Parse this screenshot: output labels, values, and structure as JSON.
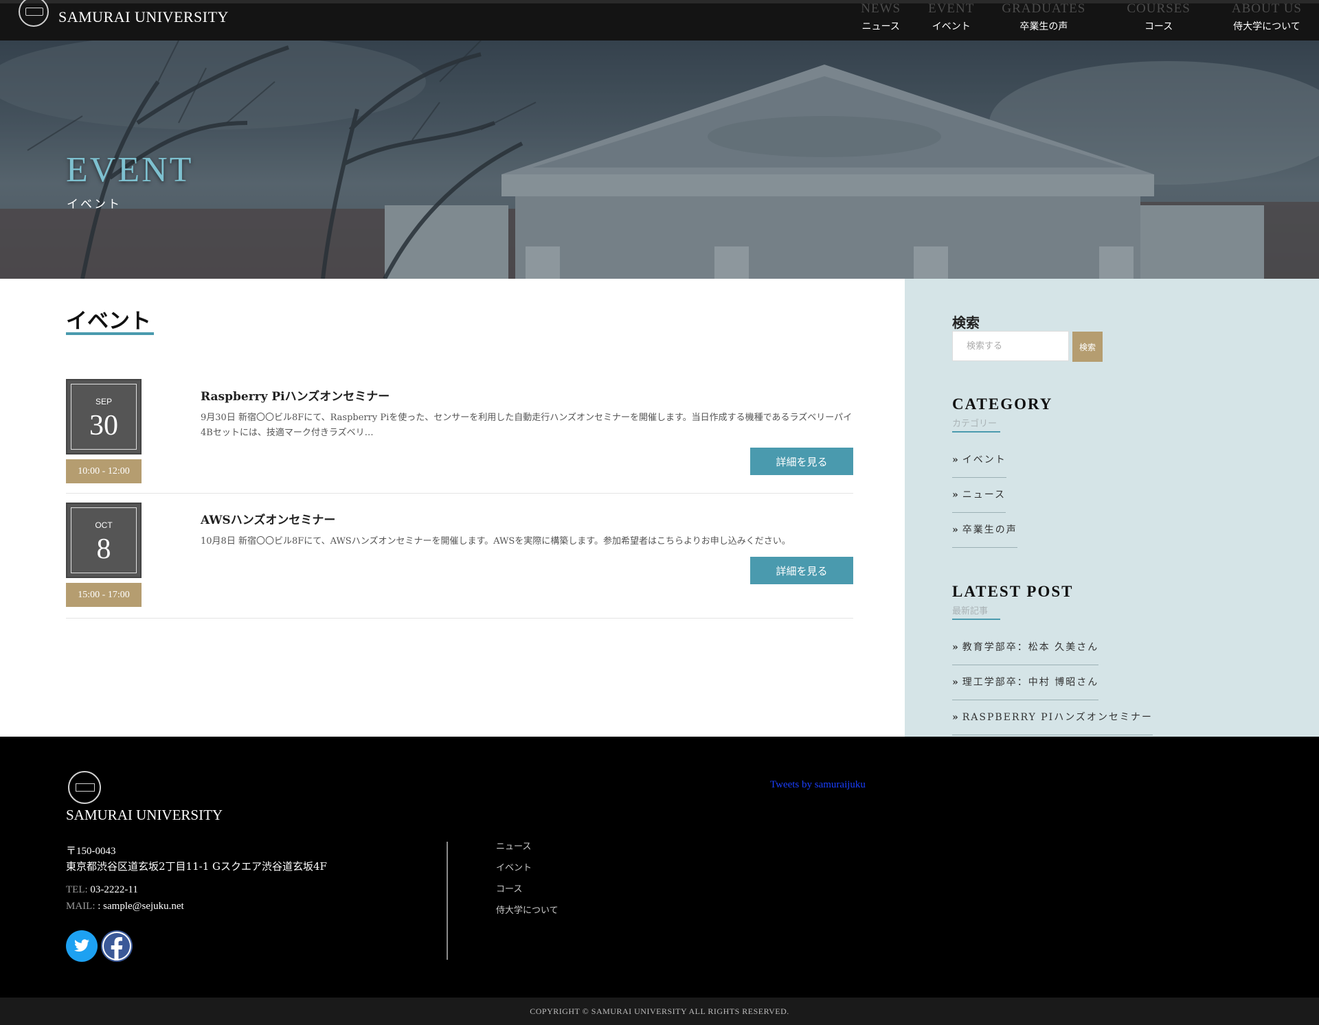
{
  "header": {
    "logo_text": "SAMURAI UNIVERSITY",
    "nav": [
      {
        "en": "NEWS",
        "ja": "ニュース"
      },
      {
        "en": "EVENT",
        "ja": "イベント"
      },
      {
        "en": "GRADUATES",
        "ja": "卒業生の声"
      },
      {
        "en": "COURSES",
        "ja": "コース"
      },
      {
        "en": "ABOUT US",
        "ja": "侍大学について"
      }
    ]
  },
  "hero": {
    "title": "EVENT",
    "subtitle": "イベント"
  },
  "main": {
    "heading": "イベント",
    "events": [
      {
        "month": "SEP",
        "day": "30",
        "time": "10:00 - 12:00",
        "title": "Raspberry Piハンズオンセミナー",
        "description": "9月30日 新宿〇〇ビル8Fにて、Raspberry Piを使った、センサーを利用した自動走行ハンズオンセミナーを開催します。当日作成する機種であるラズベリーパイ4Bセットには、技適マーク付きラズベリ…",
        "button": "詳細を見る"
      },
      {
        "month": "OCT",
        "day": "8",
        "time": "15:00 - 17:00",
        "title": "AWSハンズオンセミナー",
        "description": "10月8日 新宿〇〇ビル8Fにて、AWSハンズオンセミナーを開催します。AWSを実際に構築します。参加希望者はこちらよりお申し込みください。",
        "button": "詳細を見る"
      }
    ]
  },
  "sidebar": {
    "search": {
      "title": "検索",
      "placeholder": "検索する",
      "button": "検索"
    },
    "category": {
      "heading": "CATEGORY",
      "sub": "カテゴリー",
      "items": [
        "イベント",
        "ニュース",
        "卒業生の声"
      ]
    },
    "latest": {
      "heading": "LATEST POST",
      "sub": "最新記事",
      "items": [
        "教育学部卒：松本 久美さん",
        "理工学部卒：中村 博昭さん",
        "RASPBERRY PIハンズオンセミナー"
      ]
    }
  },
  "footer": {
    "logo_text": "SAMURAI UNIVERSITY",
    "postal": "〒150-0043",
    "address": "東京都渋谷区道玄坂2丁目11-1 Gスクエア渋谷道玄坂4F",
    "tel_label": "TEL:",
    "tel": "03-2222-11",
    "mail_label": "MAIL:",
    "mail": ": sample@sejuku.net",
    "links": [
      "ニュース",
      "イベント",
      "コース",
      "侍大学について"
    ],
    "tweets": "Tweets by samuraijuku",
    "copyright": "COPYRIGHT © SAMURAI UNIVERSITY ALL RIGHTS RESERVED."
  },
  "colors": {
    "accent": "#4a9aae",
    "gold": "#b59d70",
    "sidebar_bg": "#d5e4e7",
    "hero_title": "#7ec1d0"
  }
}
